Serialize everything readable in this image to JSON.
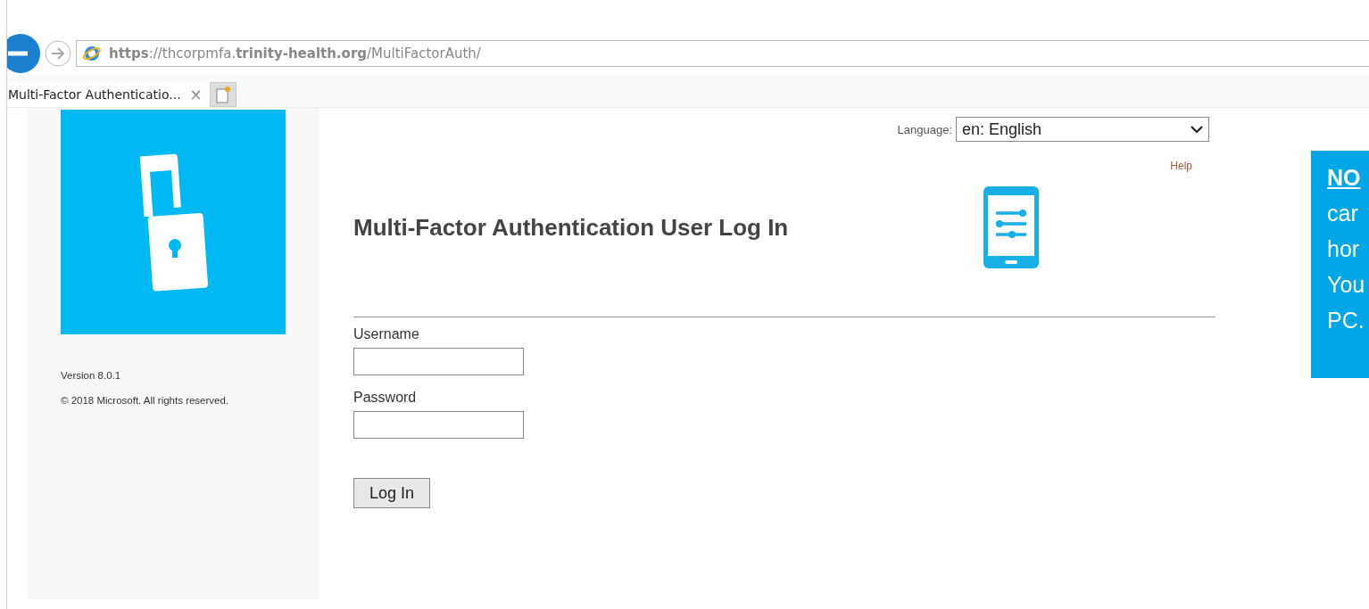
{
  "browser": {
    "address": "**https**://thcorpmfa.**trinity-health.org**/MultiFactorAuth/",
    "tabs": [
      {
        "title": "Multi-Factor Authenticatio...",
        "close": "×",
        "selected": true
      }
    ]
  },
  "sidebar": {
    "version": "Version 8.0.1",
    "copyright": "© 2018 Microsoft. All rights reserved."
  },
  "language": {
    "label": "Language:",
    "value": "en: English"
  },
  "help": "Help",
  "heading": "Multi-Factor Authentication User Log In",
  "form": {
    "fields": [
      {
        "label": "Username"
      },
      {
        "label": "Password"
      }
    ],
    "button": "Log In"
  },
  "note": {
    "heading": "NO",
    "lines": [
      "car",
      "hor",
      "You",
      "PC."
    ]
  }
}
